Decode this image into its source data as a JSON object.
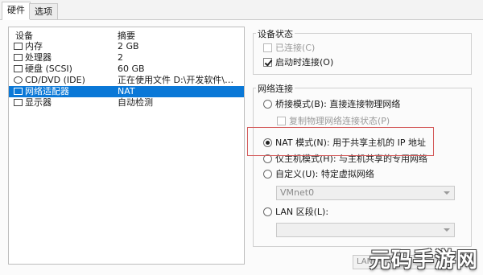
{
  "tabs": [
    {
      "label": "硬件"
    },
    {
      "label": "选项"
    }
  ],
  "device_list": {
    "headers": {
      "device": "设备",
      "summary": "摘要"
    },
    "items": [
      {
        "name": "内存",
        "summary": "2 GB",
        "icon": "memory-icon"
      },
      {
        "name": "处理器",
        "summary": "2",
        "icon": "cpu-icon"
      },
      {
        "name": "硬盘 (SCSI)",
        "summary": "60 GB",
        "icon": "disk-icon"
      },
      {
        "name": "CD/DVD (IDE)",
        "summary": "正在使用文件 D:\\开发软件\\Ce...",
        "icon": "cd-icon"
      },
      {
        "name": "网络适配器",
        "summary": "NAT",
        "icon": "network-icon",
        "selected": true
      },
      {
        "name": "显示器",
        "summary": "自动检测",
        "icon": "monitor-icon"
      }
    ]
  },
  "device_status": {
    "title": "设备状态",
    "connected": "已连接(C)",
    "connect_on_power": "启动时连接(O)"
  },
  "network": {
    "title": "网络连接",
    "bridged": "桥接模式(B): 直接连接物理网络",
    "replicate": "复制物理网络连接状态(P)",
    "nat": "NAT 模式(N): 用于共享主机的 IP 地址",
    "hostonly": "仅主机模式(H): 与主机共享的专用网络",
    "custom": "自定义(U): 特定虚拟网络",
    "vmnet": "VMnet0",
    "lan": "LAN 区段(L):",
    "lan_select": ""
  },
  "lan_button": "LAN 区",
  "watermark": "元码手游网",
  "colors": {
    "selection": "#0a78d7",
    "highlight_box": "#d45a5a"
  }
}
